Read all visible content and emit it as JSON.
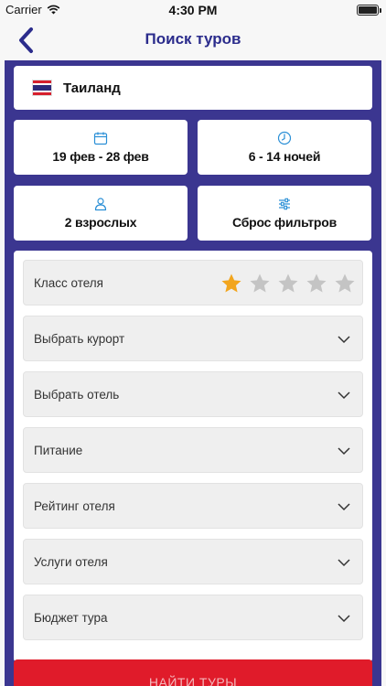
{
  "status_bar": {
    "carrier": "Carrier",
    "time": "4:30 PM"
  },
  "nav": {
    "title": "Поиск туров"
  },
  "country": {
    "name": "Таиланд"
  },
  "tiles": {
    "dates": "19 фев - 28 фев",
    "nights": "6 - 14 ночей",
    "travelers": "2 взрослых",
    "reset": "Сброс фильтров"
  },
  "filters": {
    "hotel_class": {
      "label": "Класс отеля",
      "rating": 1,
      "max": 5
    },
    "resort": "Выбрать курорт",
    "hotel": "Выбрать отель",
    "meals": "Питание",
    "hotel_rating": "Рейтинг отеля",
    "hotel_services": "Услуги отеля",
    "budget": "Бюджет тура"
  },
  "search_button": {
    "label": "НАЙТИ ТУРЫ"
  },
  "colors": {
    "primary": "#3b3690",
    "nav_title": "#2b2c8c",
    "accent_blue": "#2a8fd6",
    "star_active": "#f2a51d",
    "star_inactive": "#c4c4c4",
    "button": "#e01b2a"
  },
  "icons": {
    "back": "chevron-left-icon",
    "calendar": "calendar-icon",
    "clock": "clock-icon",
    "person": "person-icon",
    "sliders": "sliders-icon",
    "chevron": "chevron-down-icon",
    "star": "star-icon",
    "flag": "thailand-flag-icon"
  }
}
